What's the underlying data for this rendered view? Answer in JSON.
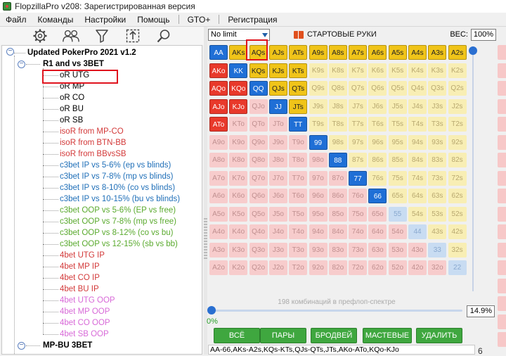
{
  "window": {
    "title": "FlopzillaPro v208: Зарегистрированная версия"
  },
  "menu": [
    "Файл",
    "Команды",
    "Настройки",
    "Помощь",
    "GTO+",
    "Регистрация"
  ],
  "toolbar_icons": [
    "gear-icon",
    "users-icon",
    "filter-icon",
    "upload-icon",
    "search-icon"
  ],
  "tree": {
    "root": "Updated PokerPro 2021 v1.2",
    "groups": [
      {
        "label": "R1 and vs 3BET",
        "items": [
          {
            "label": "oR UTG",
            "color": "#000000"
          },
          {
            "label": "oR MP",
            "color": "#000000"
          },
          {
            "label": "oR CO",
            "color": "#000000"
          },
          {
            "label": "oR BU",
            "color": "#000000"
          },
          {
            "label": "oR SB",
            "color": "#000000"
          },
          {
            "label": "isoR from MP-CO",
            "color": "#d33a3a"
          },
          {
            "label": "isoR from BTN-BB",
            "color": "#d33a3a"
          },
          {
            "label": "isoR from BBvsSB",
            "color": "#d33a3a"
          },
          {
            "label": "c3bet IP vs 5-6% (ep vs blinds)",
            "color": "#1f6fb8"
          },
          {
            "label": "c3bet IP vs 7-8% (mp vs blinds)",
            "color": "#1f6fb8"
          },
          {
            "label": "c3bet IP vs 8-10% (co vs blinds)",
            "color": "#1f6fb8"
          },
          {
            "label": "c3bet IP vs 10-15% (bu vs blinds)",
            "color": "#1f6fb8"
          },
          {
            "label": "c3bet OOP vs 5-6% (EP vs free)",
            "color": "#5aaa2e"
          },
          {
            "label": "c3bet OOP vs 7-8% (mp vs free)",
            "color": "#5aaa2e"
          },
          {
            "label": "c3bet OOP vs 8-12% (co vs bu)",
            "color": "#5aaa2e"
          },
          {
            "label": "c3bet OOP vs 12-15% (sb vs bb)",
            "color": "#5aaa2e"
          },
          {
            "label": "4bet UTG IP",
            "color": "#d33a3a"
          },
          {
            "label": "4bet MP IP",
            "color": "#d33a3a"
          },
          {
            "label": "4bet CO IP",
            "color": "#d33a3a"
          },
          {
            "label": "4bet BU IP",
            "color": "#d33a3a"
          },
          {
            "label": "4bet UTG OOP",
            "color": "#d86ad8"
          },
          {
            "label": "4bet MP OOP",
            "color": "#d86ad8"
          },
          {
            "label": "4bet CO OOP",
            "color": "#d86ad8"
          },
          {
            "label": "4bet SB OOP",
            "color": "#d86ad8"
          }
        ]
      },
      {
        "label": "MP-BU 3BET",
        "items": []
      }
    ]
  },
  "top": {
    "select_value": "No limit",
    "starting_hands_label": "СТАРТОВЫЕ РУКИ",
    "weight_label": "ВЕС:",
    "weight_value": "100%"
  },
  "matrix": {
    "ranks": [
      "A",
      "K",
      "Q",
      "J",
      "T",
      "9",
      "8",
      "7",
      "6",
      "5",
      "4",
      "3",
      "2"
    ],
    "selected": [
      "AA",
      "AKs",
      "AQs",
      "AJs",
      "ATs",
      "A9s",
      "A8s",
      "A7s",
      "A6s",
      "A5s",
      "A4s",
      "A3s",
      "A2s",
      "AKo",
      "KK",
      "KQs",
      "KJs",
      "KTs",
      "AQo",
      "KQo",
      "QQ",
      "QJs",
      "QTs",
      "AJo",
      "KJo",
      "JJ",
      "JTs",
      "ATo",
      "TT",
      "99",
      "88",
      "77",
      "66"
    ],
    "colors": {
      "pair_selected": "#1f6fd6",
      "pair_unselected": "#c8dcf2",
      "suited_selected": "#f0c419",
      "suited_unselected": "#f8eeb4",
      "offsuit_selected": "#e8392b",
      "offsuit_unselected": "#f7cccc"
    }
  },
  "stats": {
    "combos_text": "198 комбинаций в префлоп-спектре",
    "percent": "14.9%",
    "percent_value": 14.9,
    "slider_min": "0%"
  },
  "buttons": [
    "ВСЁ",
    "ПАРЫ",
    "БРОДВЕЙ",
    "МАСТЕВЫЕ",
    "УДАЛИТЬ"
  ],
  "range_text": "AA-66,AKs-A2s,KQs-KTs,QJs-QTs,JTs,AKo-ATo,KQo-KJo",
  "corner_number": "6"
}
